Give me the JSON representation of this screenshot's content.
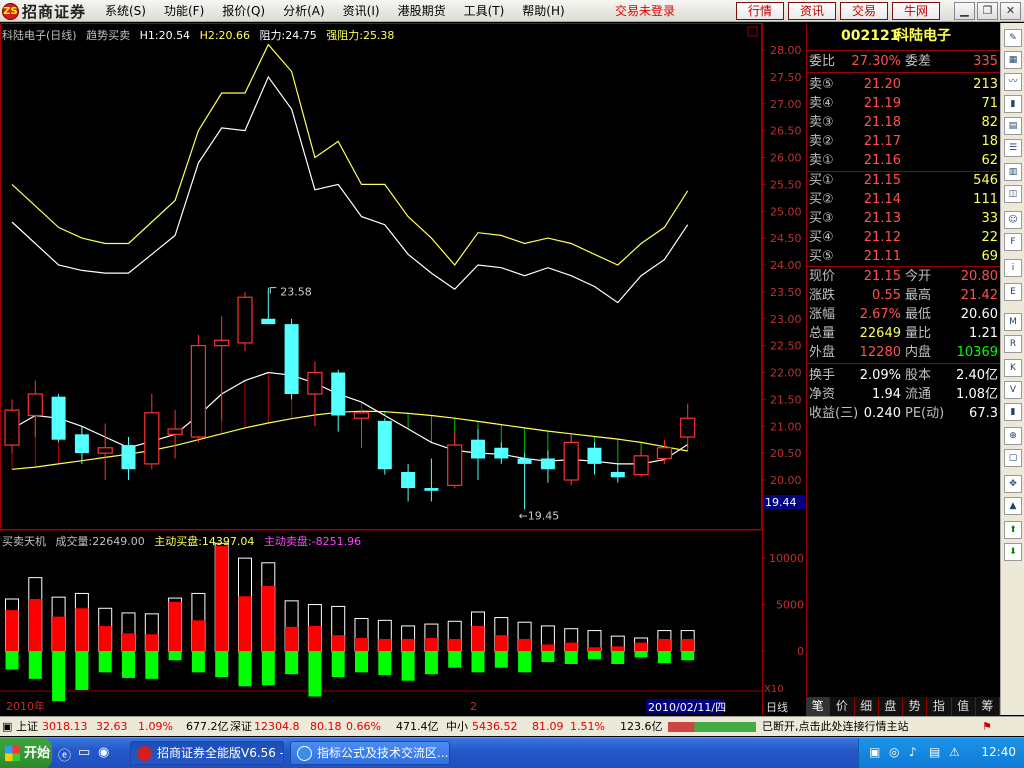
{
  "app": {
    "title": "招商证券",
    "logo_text": "招商证券",
    "menus": [
      "系统(S)",
      "功能(F)",
      "报价(Q)",
      "分析(A)",
      "资讯(I)",
      "港股期货",
      "工具(T)",
      "帮助(H)"
    ],
    "trade_status": "交易未登录",
    "quick_buttons": [
      "行情",
      "资讯",
      "交易",
      "牛网"
    ],
    "window_controls": [
      "minimize",
      "restore",
      "close"
    ]
  },
  "chart_header": {
    "name": "科陆电子(日线)",
    "indicator": "趋势买卖",
    "h1": "H1:20.54",
    "h2": "H2:20.66",
    "resistance": "阻力:24.75",
    "strong_resistance": "强阻力:25.38"
  },
  "volume_header": {
    "name": "买卖天机",
    "volume": "成交量:22649.00",
    "active_buy": "主动买盘:14397.04",
    "active_sell": "主动卖盘:-8251.96"
  },
  "price_axis": {
    "ticks": [
      "28.00",
      "27.50",
      "27.00",
      "26.50",
      "26.00",
      "25.50",
      "25.00",
      "24.50",
      "24.00",
      "23.50",
      "23.00",
      "22.50",
      "22.00",
      "21.50",
      "21.00",
      "20.50",
      "20.00"
    ],
    "current_label": "19.44"
  },
  "volume_axis": {
    "ticks": [
      "10000",
      "5000",
      "0"
    ],
    "multiplier": "X10"
  },
  "x_axis": {
    "year_label": "2010年",
    "month_label": "2",
    "date_label": "2010/02/11/四",
    "period_label": "日线"
  },
  "annotations": {
    "high": "23.58",
    "low": "19.45"
  },
  "colors": {
    "up": "#ff3232",
    "down": "#54ffff",
    "line_yellow": "#ffff54",
    "line_white": "#ffffff",
    "vol_buy": "#ff0000",
    "vol_sell": "#00ff00"
  },
  "chart_data": {
    "type": "candlestick",
    "ylim": [
      19.2,
      28.2
    ],
    "candles": [
      {
        "o": 20.65,
        "h": 21.5,
        "l": 20.5,
        "c": 21.3
      },
      {
        "o": 21.2,
        "h": 21.85,
        "l": 20.8,
        "c": 21.6
      },
      {
        "o": 21.55,
        "h": 21.6,
        "l": 20.7,
        "c": 20.75
      },
      {
        "o": 20.85,
        "h": 21.0,
        "l": 20.3,
        "c": 20.5
      },
      {
        "o": 20.5,
        "h": 21.05,
        "l": 20.0,
        "c": 20.6
      },
      {
        "o": 20.65,
        "h": 20.8,
        "l": 20.0,
        "c": 20.2
      },
      {
        "o": 20.3,
        "h": 21.6,
        "l": 20.2,
        "c": 21.25
      },
      {
        "o": 20.85,
        "h": 21.3,
        "l": 20.4,
        "c": 20.95
      },
      {
        "o": 20.8,
        "h": 22.7,
        "l": 20.7,
        "c": 22.5
      },
      {
        "o": 22.5,
        "h": 23.05,
        "l": 21.1,
        "c": 22.6
      },
      {
        "o": 22.55,
        "h": 23.5,
        "l": 22.4,
        "c": 23.4
      },
      {
        "o": 23.0,
        "h": 23.58,
        "l": 22.9,
        "c": 22.9
      },
      {
        "o": 22.9,
        "h": 23.0,
        "l": 21.5,
        "c": 21.6
      },
      {
        "o": 21.6,
        "h": 22.2,
        "l": 21.0,
        "c": 22.0
      },
      {
        "o": 22.0,
        "h": 22.05,
        "l": 20.9,
        "c": 21.2
      },
      {
        "o": 21.15,
        "h": 21.3,
        "l": 20.6,
        "c": 21.25
      },
      {
        "o": 21.1,
        "h": 21.15,
        "l": 20.1,
        "c": 20.2
      },
      {
        "o": 20.15,
        "h": 20.3,
        "l": 19.6,
        "c": 19.85
      },
      {
        "o": 19.85,
        "h": 20.4,
        "l": 19.6,
        "c": 19.8
      },
      {
        "o": 19.9,
        "h": 20.9,
        "l": 19.85,
        "c": 20.65
      },
      {
        "o": 20.75,
        "h": 20.95,
        "l": 20.0,
        "c": 20.4
      },
      {
        "o": 20.6,
        "h": 20.7,
        "l": 20.3,
        "c": 20.4
      },
      {
        "o": 20.4,
        "h": 20.5,
        "l": 19.45,
        "c": 20.3
      },
      {
        "o": 20.4,
        "h": 20.55,
        "l": 19.95,
        "c": 20.2
      },
      {
        "o": 20.0,
        "h": 20.85,
        "l": 19.9,
        "c": 20.7
      },
      {
        "o": 20.6,
        "h": 20.7,
        "l": 20.1,
        "c": 20.3
      },
      {
        "o": 20.15,
        "h": 20.3,
        "l": 19.95,
        "c": 20.05
      },
      {
        "o": 20.1,
        "h": 20.55,
        "l": 20.05,
        "c": 20.45
      },
      {
        "o": 20.4,
        "h": 20.75,
        "l": 20.3,
        "c": 20.6
      },
      {
        "o": 20.8,
        "h": 21.42,
        "l": 20.6,
        "c": 21.15
      }
    ],
    "upper_band": [
      25.5,
      25.1,
      24.7,
      24.5,
      24.4,
      24.4,
      24.8,
      25.2,
      26.5,
      27.2,
      27.2,
      28.1,
      27.6,
      26.0,
      26.3,
      25.5,
      25.5,
      24.9,
      24.5,
      24.0,
      24.6,
      24.55,
      24.4,
      24.5,
      24.4,
      24.2,
      24.0,
      24.4,
      24.7,
      25.38
    ],
    "lower_band": [
      24.8,
      24.4,
      24.0,
      23.9,
      23.85,
      23.85,
      24.2,
      24.55,
      25.9,
      26.55,
      26.5,
      27.5,
      26.9,
      25.4,
      25.5,
      24.9,
      24.75,
      24.2,
      23.85,
      23.55,
      24.0,
      23.95,
      23.8,
      23.95,
      23.8,
      23.6,
      23.3,
      23.8,
      24.1,
      24.75
    ],
    "ma_white": [
      20.95,
      21.2,
      21.15,
      21.0,
      20.8,
      20.6,
      20.72,
      20.85,
      21.2,
      21.6,
      21.85,
      22.0,
      21.95,
      21.8,
      21.6,
      21.45,
      21.2,
      20.95,
      20.7,
      20.55,
      20.5,
      20.48,
      20.4,
      20.35,
      20.38,
      20.35,
      20.3,
      20.3,
      20.38,
      20.66
    ],
    "ma_yellow": [
      20.2,
      20.24,
      20.3,
      20.36,
      20.42,
      20.48,
      20.55,
      20.64,
      20.75,
      20.86,
      20.97,
      21.06,
      21.14,
      21.21,
      21.26,
      21.28,
      21.27,
      21.24,
      21.2,
      21.15,
      21.09,
      21.03,
      20.97,
      20.91,
      20.86,
      20.81,
      20.76,
      20.7,
      20.62,
      20.54
    ],
    "volume": {
      "ylim": [
        -5500,
        14000
      ],
      "total": [
        5600,
        7900,
        5800,
        6200,
        4600,
        4100,
        4000,
        5700,
        6200,
        11600,
        10000,
        9500,
        5400,
        5000,
        4800,
        3500,
        3300,
        2700,
        2900,
        3200,
        4200,
        3600,
        3100,
        2700,
        2400,
        2200,
        1600,
        1400,
        2200,
        2200
      ],
      "buy": [
        4400,
        5600,
        3700,
        4600,
        2700,
        1900,
        1800,
        5300,
        3300,
        11300,
        5900,
        7000,
        2600,
        2700,
        1700,
        1400,
        1300,
        1300,
        1400,
        1300,
        2700,
        1700,
        1300,
        700,
        900,
        400,
        500,
        900,
        1300,
        1300
      ],
      "sell": [
        -2000,
        -3000,
        -5400,
        -4200,
        -2300,
        -2900,
        -3000,
        -1000,
        -2300,
        -2800,
        -3800,
        -3700,
        -2500,
        -4900,
        -2800,
        -2300,
        -2600,
        -3200,
        -2500,
        -1800,
        -2300,
        -1800,
        -2300,
        -1200,
        -1400,
        -900,
        -1400,
        -700,
        -1300,
        -1000
      ]
    }
  },
  "quote": {
    "code": "002121",
    "name": "科陆电子",
    "weibi_label": "委比",
    "weibi": "27.30%",
    "weicha_label": "委差",
    "weicha": "335",
    "sells": [
      {
        "label": "卖⑤",
        "price": "21.20",
        "vol": "213"
      },
      {
        "label": "卖④",
        "price": "21.19",
        "vol": "71"
      },
      {
        "label": "卖③",
        "price": "21.18",
        "vol": "82"
      },
      {
        "label": "卖②",
        "price": "21.17",
        "vol": "18"
      },
      {
        "label": "卖①",
        "price": "21.16",
        "vol": "62"
      }
    ],
    "buys": [
      {
        "label": "买①",
        "price": "21.15",
        "vol": "546"
      },
      {
        "label": "买②",
        "price": "21.14",
        "vol": "111"
      },
      {
        "label": "买③",
        "price": "21.13",
        "vol": "33"
      },
      {
        "label": "买④",
        "price": "21.12",
        "vol": "22"
      },
      {
        "label": "买⑤",
        "price": "21.11",
        "vol": "69"
      }
    ],
    "stats": [
      {
        "k1": "现价",
        "v1": "21.15",
        "k2": "今开",
        "v2": "20.80",
        "c1": "#ff5050",
        "c2": "#ff5050"
      },
      {
        "k1": "涨跌",
        "v1": "0.55",
        "k2": "最高",
        "v2": "21.42",
        "c1": "#ff5050",
        "c2": "#ff5050"
      },
      {
        "k1": "涨幅",
        "v1": "2.67%",
        "k2": "最低",
        "v2": "20.60",
        "c1": "#ff5050",
        "c2": "#ffffff"
      },
      {
        "k1": "总量",
        "v1": "22649",
        "k2": "量比",
        "v2": "1.21",
        "c1": "#ffff54",
        "c2": "#ffffff"
      },
      {
        "k1": "外盘",
        "v1": "12280",
        "k2": "内盘",
        "v2": "10369",
        "c1": "#ff5050",
        "c2": "#00ff00"
      },
      {
        "k1": "换手",
        "v1": "2.09%",
        "k2": "股本",
        "v2": "2.40亿",
        "c1": "#ffffff",
        "c2": "#ffffff"
      },
      {
        "k1": "净资",
        "v1": "1.94",
        "k2": "流通",
        "v2": "1.08亿",
        "c1": "#ffffff",
        "c2": "#ffffff"
      },
      {
        "k1": "收益(三)",
        "v1": "0.240",
        "k2": "PE(动)",
        "v2": "67.3",
        "c1": "#ffffff",
        "c2": "#ffffff"
      }
    ]
  },
  "bottom_tabs": [
    "笔",
    "价",
    "细",
    "盘",
    "势",
    "指",
    "值",
    "筹"
  ],
  "status_bar": {
    "sh_name": "上证",
    "sh_value": "3018.13",
    "sh_change": "32.63",
    "sh_pct": "1.09%",
    "sh_amount": "677.2亿",
    "sz_name": "深证",
    "sz_value": "12304.8",
    "sz_change": "80.18",
    "sz_pct": "0.66%",
    "sz_amount": "471.4亿",
    "zx_name": "中小",
    "zx_value": "5436.52",
    "zx_change": "81.09",
    "zx_pct": "1.51%",
    "zx_amount": "123.6亿",
    "message": "已断开,点击此处连接行情主站"
  },
  "taskbar": {
    "start_label": "开始",
    "items": [
      "招商证券全能版V6.56 -...",
      "指标公式及技术交流区..."
    ],
    "clock": "12:40"
  }
}
